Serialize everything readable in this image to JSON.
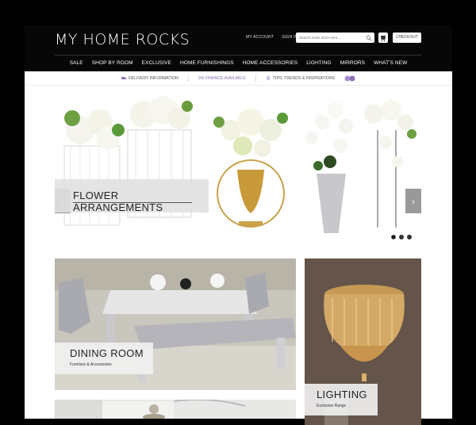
{
  "header": {
    "logo": "MY HOME ROCKS",
    "account_link": "MY ACCOUNT",
    "signin_link": "SIGN IN",
    "search_placeholder": "Search entire store here...",
    "checkout_label": "CHECKOUT"
  },
  "nav": {
    "items": [
      {
        "label": "SALE"
      },
      {
        "label": "SHOP BY ROOM"
      },
      {
        "label": "EXCLUSIVE"
      },
      {
        "label": "HOME FURNISHINGS"
      },
      {
        "label": "HOME ACCESSORIES"
      },
      {
        "label": "LIGHTING"
      },
      {
        "label": "MIRRORS"
      },
      {
        "label": "WHAT'S NEW"
      }
    ]
  },
  "infobar": {
    "delivery": "DELIVERY INFORMATION",
    "finance": "0% FINANCE AVAILABLE",
    "tips": "TIPS: TRENDS & INSPIRATIONS"
  },
  "slider": {
    "caption": "FLOWER ARRANGEMENTS",
    "prev_icon": "chevron-left-icon",
    "next_icon": "chevron-right-icon",
    "slide_count": 3,
    "active_slide": 1
  },
  "tiles": {
    "dining": {
      "title": "DINING ROOM",
      "subtitle": "Furniture & Accessories"
    },
    "lighting": {
      "title": "LIGHTING",
      "subtitle": "Exclusive Range"
    }
  },
  "colors": {
    "header_bg": "#070707",
    "page_bg": "#000000",
    "accent_purple": "#8b6fb5"
  }
}
